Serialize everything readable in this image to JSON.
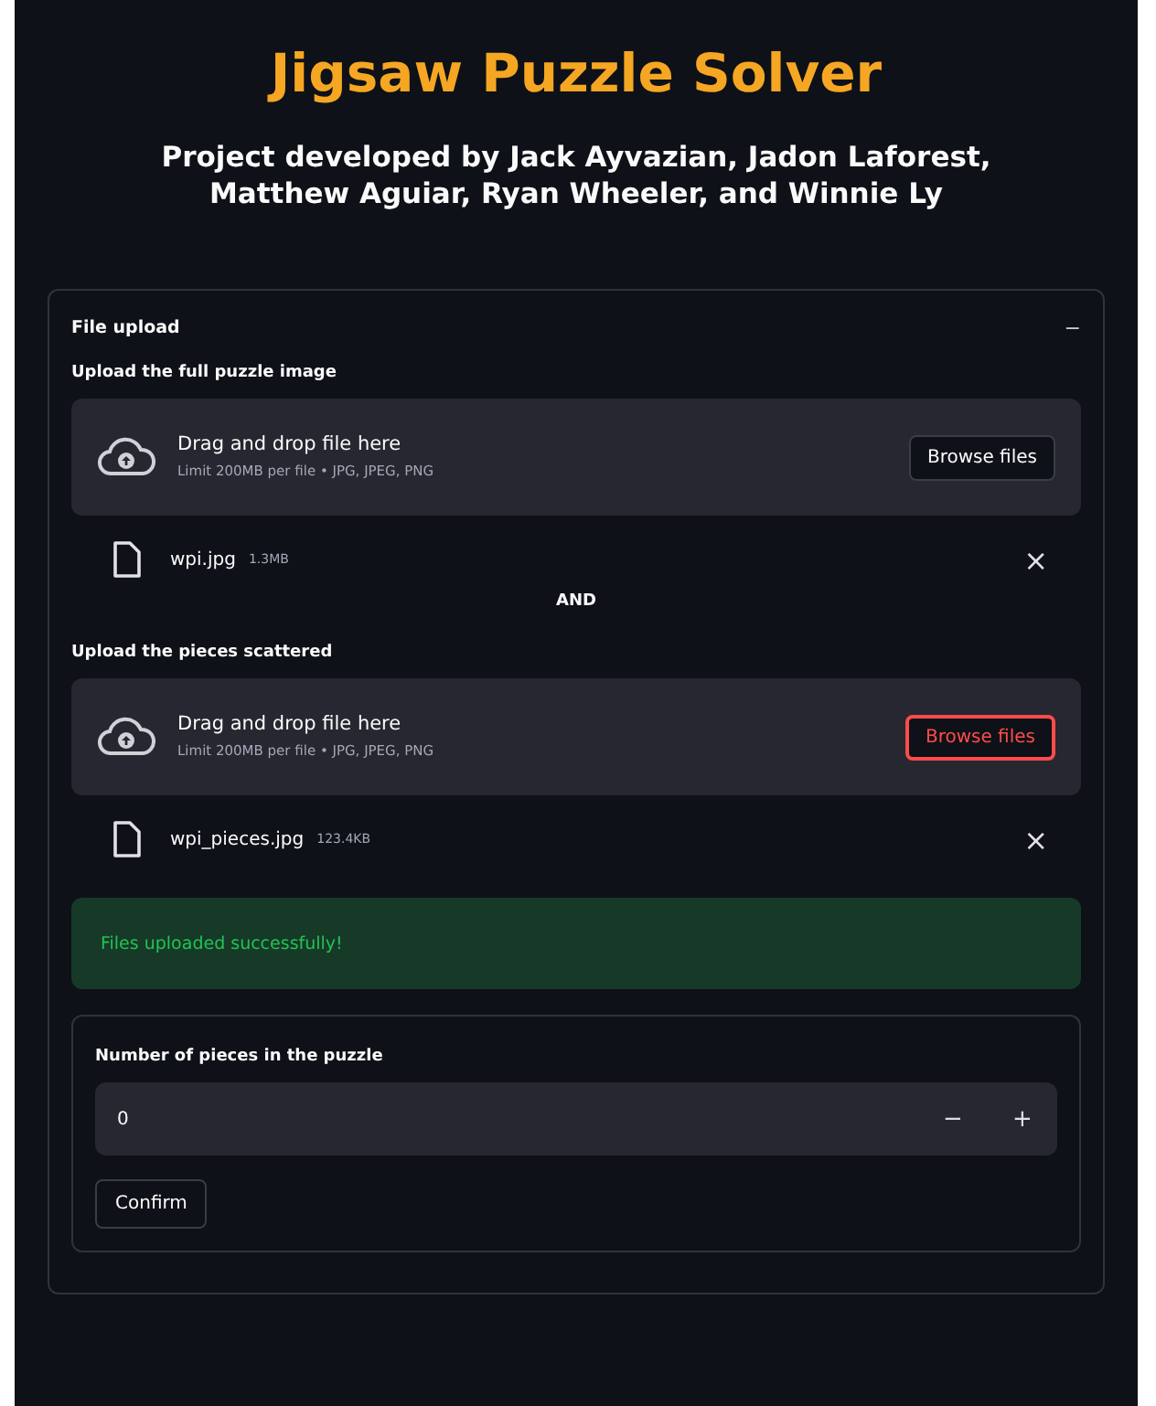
{
  "title": "Jigsaw Puzzle Solver",
  "subtitle": "Project developed by Jack Ayvazian, Jadon Laforest, Matthew Aguiar, Ryan Wheeler, and Winnie Ly",
  "expander": {
    "label": "File upload",
    "expanded": true,
    "toggle": "−"
  },
  "uploaders": [
    {
      "label": "Upload the full puzzle image",
      "drop_text": "Drag and drop file here",
      "limit_text": "Limit 200MB per file • JPG, JPEG, PNG",
      "button": "Browse files",
      "focused": false,
      "file": {
        "name": "wpi.jpg",
        "size": "1.3MB",
        "remove": "×"
      }
    },
    {
      "label": "Upload the pieces scattered",
      "drop_text": "Drag and drop file here",
      "limit_text": "Limit 200MB per file • JPG, JPEG, PNG",
      "button": "Browse files",
      "focused": true,
      "file": {
        "name": "wpi_pieces.jpg",
        "size": "123.4KB",
        "remove": "×"
      }
    }
  ],
  "separator": "AND",
  "success": "Files uploaded successfully!",
  "form": {
    "label": "Number of pieces in the puzzle",
    "value": "0",
    "minus": "−",
    "plus": "+",
    "submit": "Confirm"
  }
}
